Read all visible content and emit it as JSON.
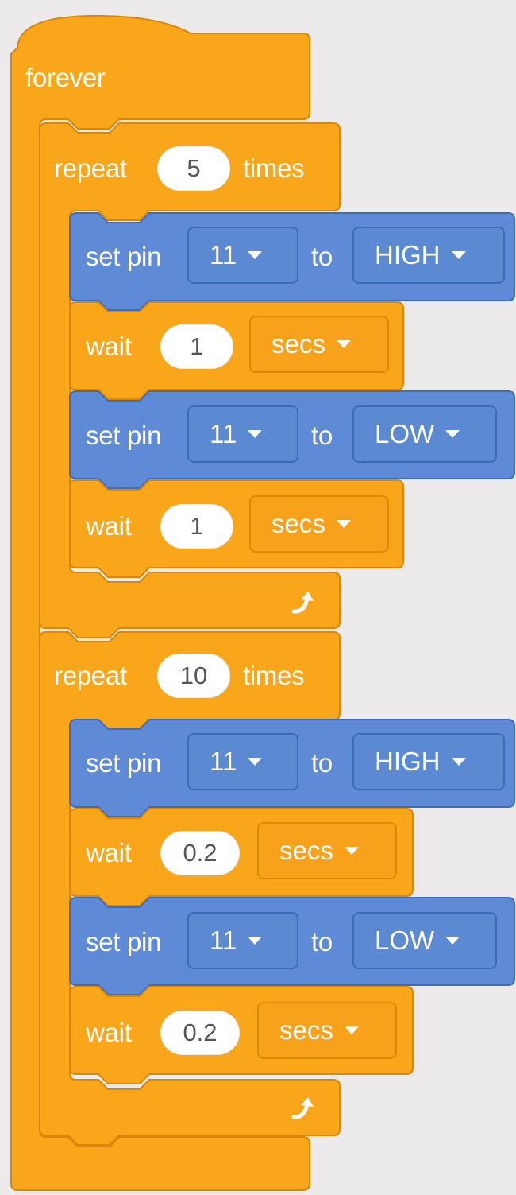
{
  "colors": {
    "control": "#FAA61A",
    "control_edge": "#D9870A",
    "pin_block": "#5F8BD6",
    "pin_edge": "#3F6CB8",
    "background": "#ECEAEA"
  },
  "forever": {
    "label": "forever"
  },
  "loops": [
    {
      "repeat_label": "repeat",
      "count": "5",
      "times_label": "times",
      "steps": [
        {
          "kind": "set_pin",
          "label": "set pin",
          "pin": "11",
          "to_label": "to",
          "level": "HIGH"
        },
        {
          "kind": "wait",
          "label": "wait",
          "duration": "1",
          "unit": "secs"
        },
        {
          "kind": "set_pin",
          "label": "set pin",
          "pin": "11",
          "to_label": "to",
          "level": "LOW"
        },
        {
          "kind": "wait",
          "label": "wait",
          "duration": "1",
          "unit": "secs"
        }
      ],
      "loop_icon": "loop-arrow-icon"
    },
    {
      "repeat_label": "repeat",
      "count": "10",
      "times_label": "times",
      "steps": [
        {
          "kind": "set_pin",
          "label": "set pin",
          "pin": "11",
          "to_label": "to",
          "level": "HIGH"
        },
        {
          "kind": "wait",
          "label": "wait",
          "duration": "0.2",
          "unit": "secs"
        },
        {
          "kind": "set_pin",
          "label": "set pin",
          "pin": "11",
          "to_label": "to",
          "level": "LOW"
        },
        {
          "kind": "wait",
          "label": "wait",
          "duration": "0.2",
          "unit": "secs"
        }
      ],
      "loop_icon": "loop-arrow-icon"
    }
  ]
}
